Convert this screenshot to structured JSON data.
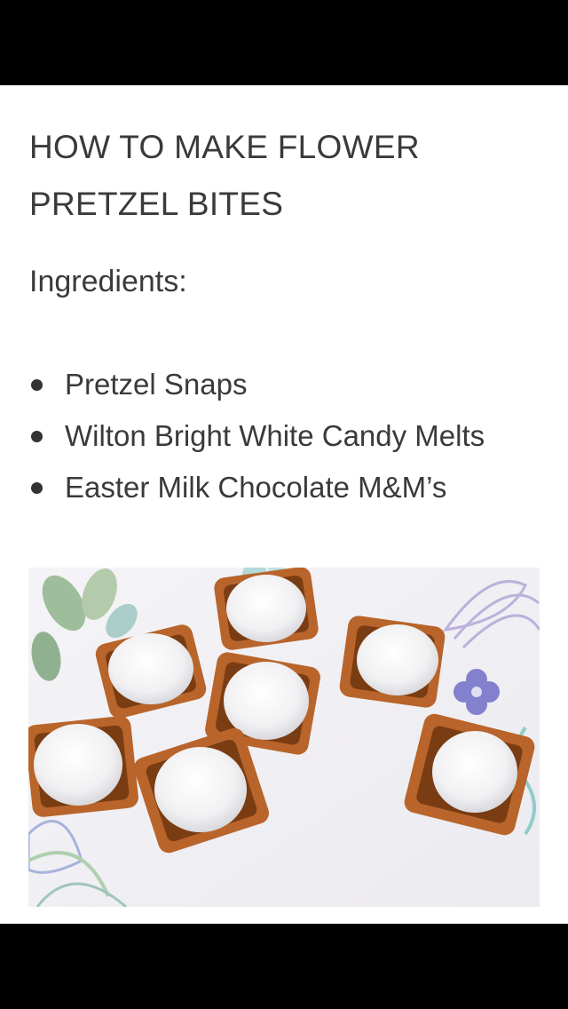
{
  "article": {
    "title": "HOW TO MAKE FLOWER PRETZEL BITES",
    "ingredients_label": "Ingredients:",
    "ingredients": [
      "Pretzel Snaps",
      "Wilton Bright White Candy Melts",
      "Easter Milk Chocolate M&M’s"
    ]
  },
  "photo": {
    "subject": "pretzel-bites-photo"
  }
}
